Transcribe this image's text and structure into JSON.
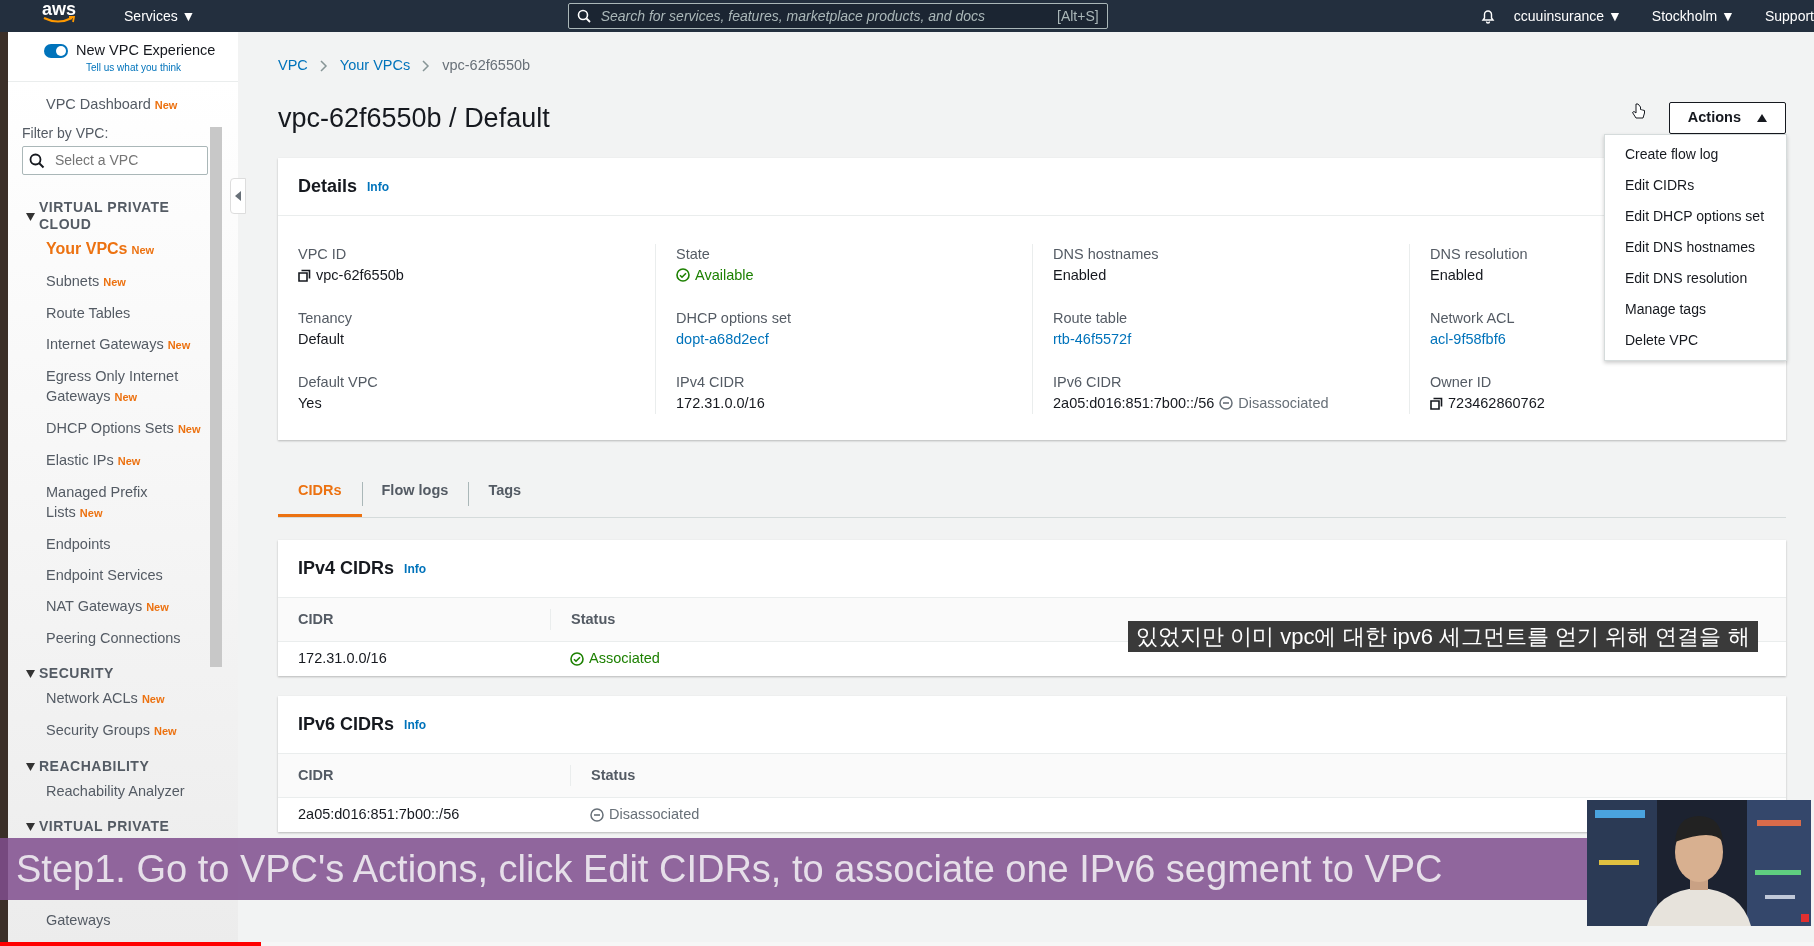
{
  "topbar": {
    "logo": "aws",
    "services": "Services ▼",
    "search": {
      "placeholder": "Search for services, features, marketplace products, and docs",
      "shortcut": "[Alt+S]"
    },
    "account": "ccuuinsurance ▼",
    "region": "Stockholm ▼",
    "support": "Support"
  },
  "sidebar": {
    "toggle": {
      "label": "New VPC Experience",
      "on": true,
      "feedback": "Tell us what you think"
    },
    "dashboard": {
      "label": "VPC Dashboard",
      "tag": "New"
    },
    "filter": {
      "label": "Filter by VPC:",
      "placeholder": "Select a VPC"
    },
    "sections": [
      {
        "title": "VIRTUAL PRIVATE CLOUD",
        "expanded": true,
        "children": [
          {
            "label": "Your VPCs",
            "tag": "New",
            "selected": true
          },
          {
            "label": "Subnets",
            "tag": "New",
            "selected": false
          },
          {
            "label": "Route Tables",
            "selected": false
          },
          {
            "label": "Internet Gateways",
            "tag": "New",
            "selected": false
          },
          {
            "label": "Egress Only Internet Gateways",
            "tag": "New",
            "selected": false
          },
          {
            "label": "DHCP Options Sets",
            "tag": "New",
            "selected": false
          },
          {
            "label": "Elastic IPs",
            "tag": "New",
            "selected": false
          },
          {
            "label": "Managed Prefix Lists",
            "tag": "New",
            "selected": false
          },
          {
            "label": "Endpoints",
            "selected": false
          },
          {
            "label": "Endpoint Services",
            "selected": false
          },
          {
            "label": "NAT Gateways",
            "tag": "New",
            "selected": false
          },
          {
            "label": "Peering Connections",
            "selected": false
          }
        ]
      },
      {
        "title": "SECURITY",
        "expanded": true,
        "children": [
          {
            "label": "Network ACLs",
            "tag": "New",
            "selected": false
          },
          {
            "label": "Security Groups",
            "tag": "New",
            "selected": false
          }
        ]
      },
      {
        "title": "REACHABILITY",
        "expanded": true,
        "children": [
          {
            "label": "Reachability Analyzer",
            "selected": false
          }
        ]
      },
      {
        "title": "VIRTUAL PRIVATE",
        "expanded": true,
        "children": [
          {
            "label": "Gateways",
            "selected": false
          }
        ]
      }
    ]
  },
  "breadcrumb": [
    "VPC",
    "Your VPCs",
    "vpc-62f6550b"
  ],
  "title": "vpc-62f6550b / Default",
  "actions": {
    "label": "Actions",
    "expanded": true,
    "menu": [
      "Create flow log",
      "Edit CIDRs",
      "Edit DHCP options set",
      "Edit DNS hostnames",
      "Edit DNS resolution",
      "Manage tags",
      "Delete VPC"
    ]
  },
  "details": {
    "title": "Details",
    "info": "Info",
    "columns": [
      [
        {
          "label": "VPC ID",
          "value": "vpc-62f6550b",
          "kind": "copy"
        },
        {
          "label": "Tenancy",
          "value": "Default",
          "kind": "text"
        },
        {
          "label": "Default VPC",
          "value": "Yes",
          "kind": "text"
        }
      ],
      [
        {
          "label": "State",
          "value": "Available",
          "kind": "ok"
        },
        {
          "label": "DHCP options set",
          "value": "dopt-a68d2ecf",
          "kind": "link"
        },
        {
          "label": "IPv4 CIDR",
          "value": "172.31.0.0/16",
          "kind": "text"
        }
      ],
      [
        {
          "label": "DNS hostnames",
          "value": "Enabled",
          "kind": "text"
        },
        {
          "label": "Route table",
          "value": "rtb-46f5572f",
          "kind": "link"
        },
        {
          "label": "IPv6 CIDR",
          "value": "2a05:d016:851:7b00::/56",
          "kind": "text",
          "status": "Disassociated"
        }
      ],
      [
        {
          "label": "DNS resolution",
          "value": "Enabled",
          "kind": "text"
        },
        {
          "label": "Network ACL",
          "value": "acl-9f58fbf6",
          "kind": "link"
        },
        {
          "label": "Owner ID",
          "value": "723462860762",
          "kind": "copy"
        }
      ]
    ]
  },
  "tabs": [
    {
      "label": "CIDRs",
      "selected": true
    },
    {
      "label": "Flow logs",
      "selected": false
    },
    {
      "label": "Tags",
      "selected": false
    }
  ],
  "tables": [
    {
      "title": "IPv4 CIDRs",
      "info": "Info",
      "columns": [
        "CIDR",
        "Status"
      ],
      "rows": [
        {
          "cidr": "172.31.0.0/16",
          "status": "Associated",
          "kind": "ok"
        }
      ]
    },
    {
      "title": "IPv6 CIDRs",
      "info": "Info",
      "columns": [
        "CIDR",
        "Status"
      ],
      "rows": [
        {
          "cidr": "2a05:d016:851:7b00::/56",
          "status": "Disassociated",
          "kind": "off"
        }
      ]
    }
  ],
  "video": {
    "caption_ko": "있었지만 이미 vpc에 대한 ipv6 세그먼트를 얻기 위해 연결을 해",
    "step_caption": "Step1. Go to VPC's Actions, click Edit CIDRs, to associate one IPv6 segment to VPC",
    "progress": {
      "level": 0.144
    }
  }
}
